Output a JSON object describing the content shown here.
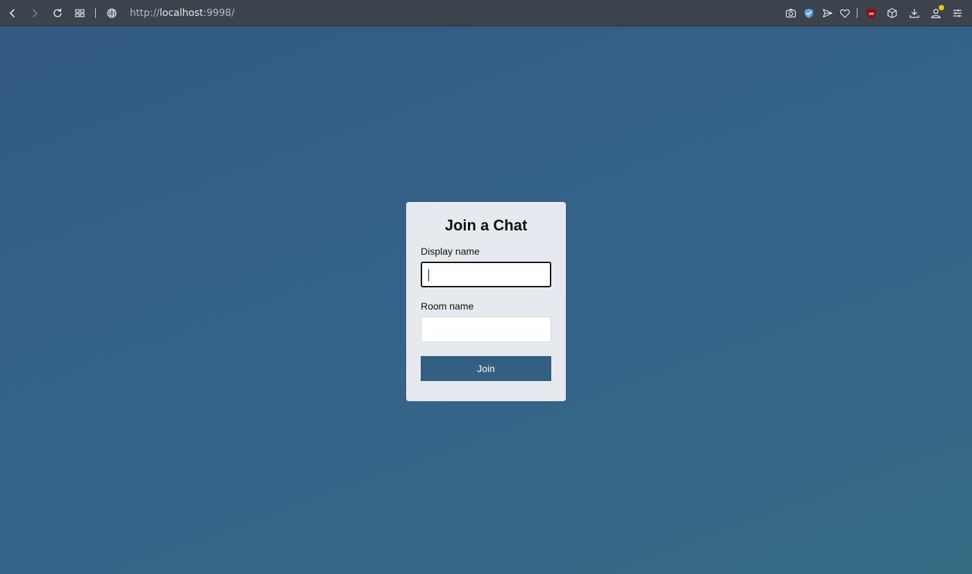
{
  "browser": {
    "url_base": "http://",
    "url_host": "localhost",
    "url_rest": ":9998/",
    "icons": [
      "back-icon",
      "forward-icon",
      "reload-icon",
      "speed-dial-icon",
      "globe-icon",
      "camera-icon",
      "shield-icon",
      "send-icon",
      "heart-icon",
      "ublock-icon",
      "cube-icon",
      "download-icon",
      "profile-icon",
      "menu-icon"
    ],
    "ublock_badge": "uo"
  },
  "page": {
    "background_color": "#34608a",
    "card": {
      "title": "Join a Chat",
      "display_name_label": "Display name",
      "display_name_value": "",
      "room_name_label": "Room name",
      "room_name_value": "",
      "join_label": "Join",
      "button_color": "#335f82"
    }
  }
}
